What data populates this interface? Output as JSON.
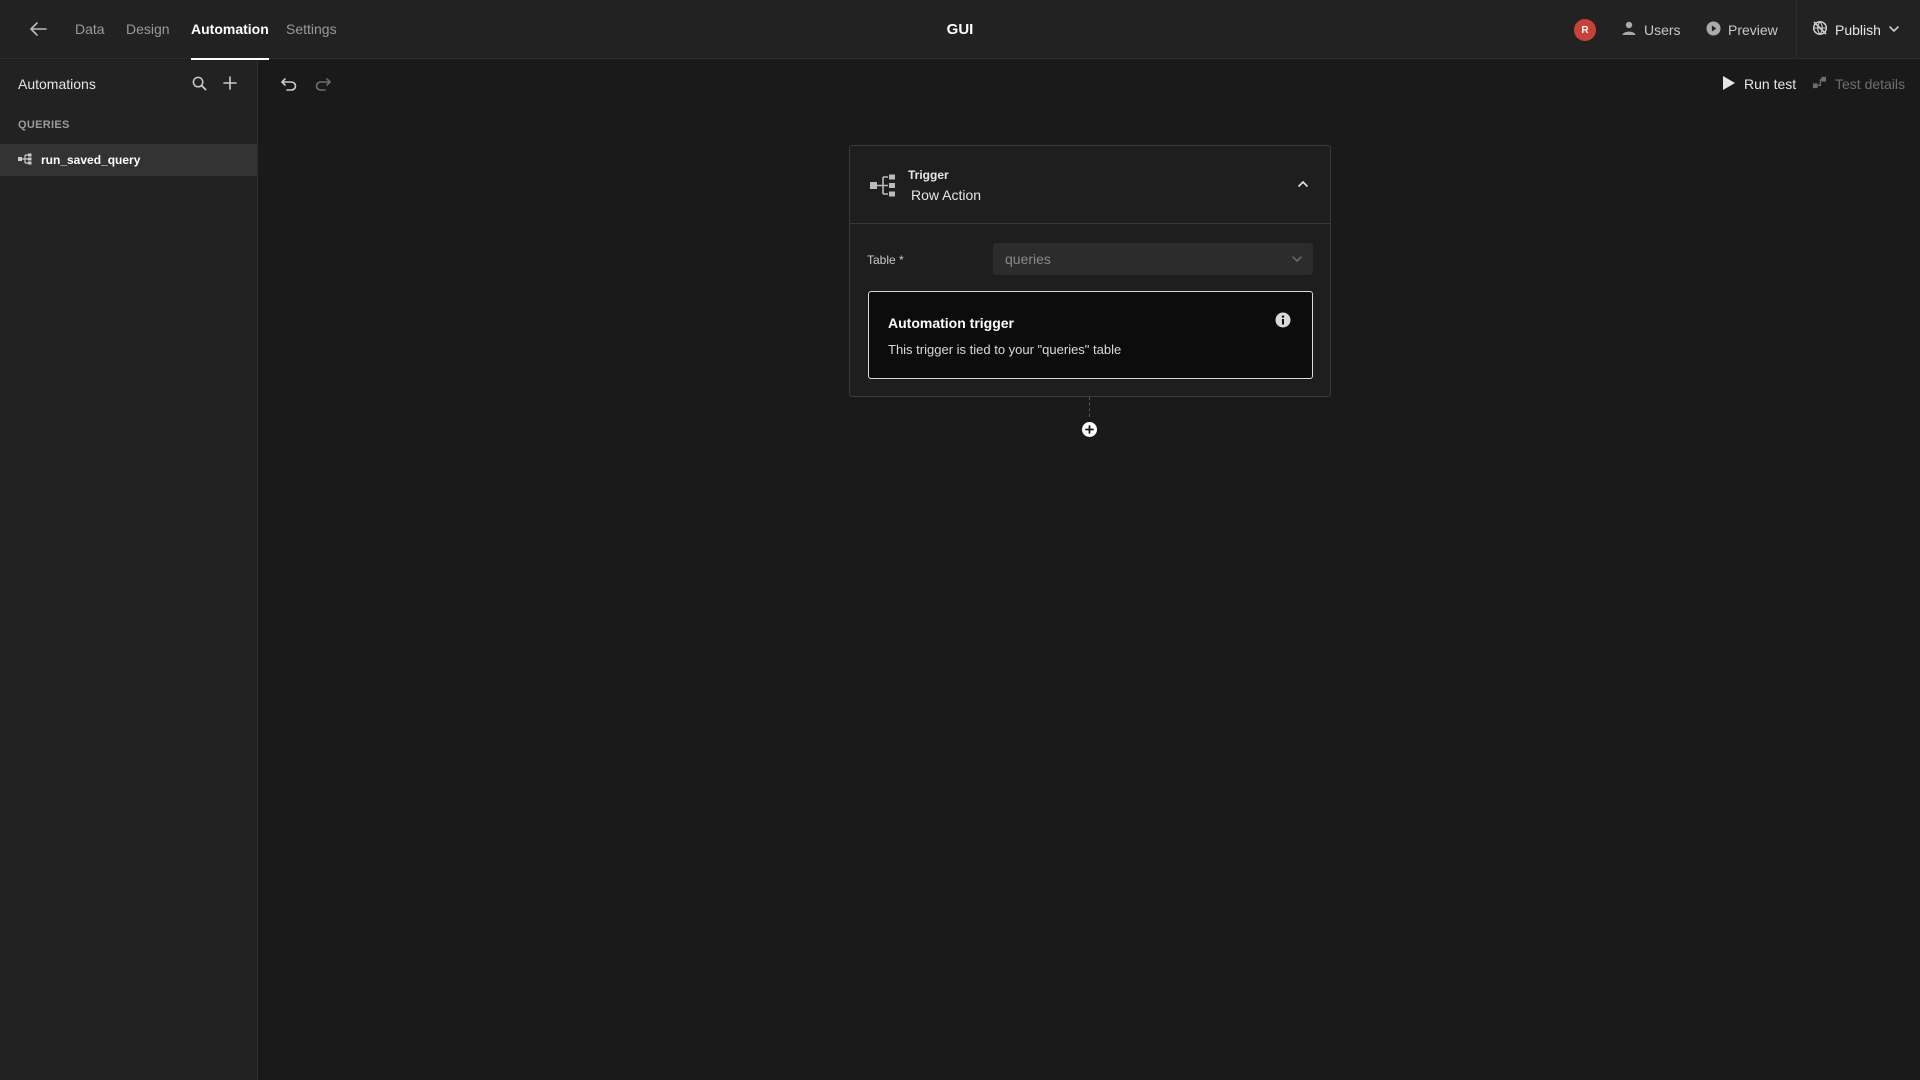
{
  "header": {
    "app_title": "GUI",
    "tabs": [
      {
        "label": "Data",
        "active": false
      },
      {
        "label": "Design",
        "active": false
      },
      {
        "label": "Automation",
        "active": true
      },
      {
        "label": "Settings",
        "active": false
      }
    ],
    "avatar_initial": "R",
    "users_label": "Users",
    "preview_label": "Preview",
    "publish_label": "Publish"
  },
  "sidebar": {
    "title": "Automations",
    "section_label": "QUERIES",
    "items": [
      {
        "label": "run_saved_query",
        "icon": "branch-icon",
        "selected": true
      }
    ]
  },
  "toolbar": {
    "run_test_label": "Run test",
    "test_details_label": "Test details"
  },
  "trigger_card": {
    "kicker": "Trigger",
    "name": "Row Action",
    "table_field_label": "Table *",
    "table_value": "queries",
    "info_title": "Automation trigger",
    "info_text": "This trigger is tied to your \"queries\" table"
  },
  "colors": {
    "background": "#1a1a1a",
    "panel": "#222222",
    "selected_item": "#333333",
    "avatar": "#c8423a"
  }
}
